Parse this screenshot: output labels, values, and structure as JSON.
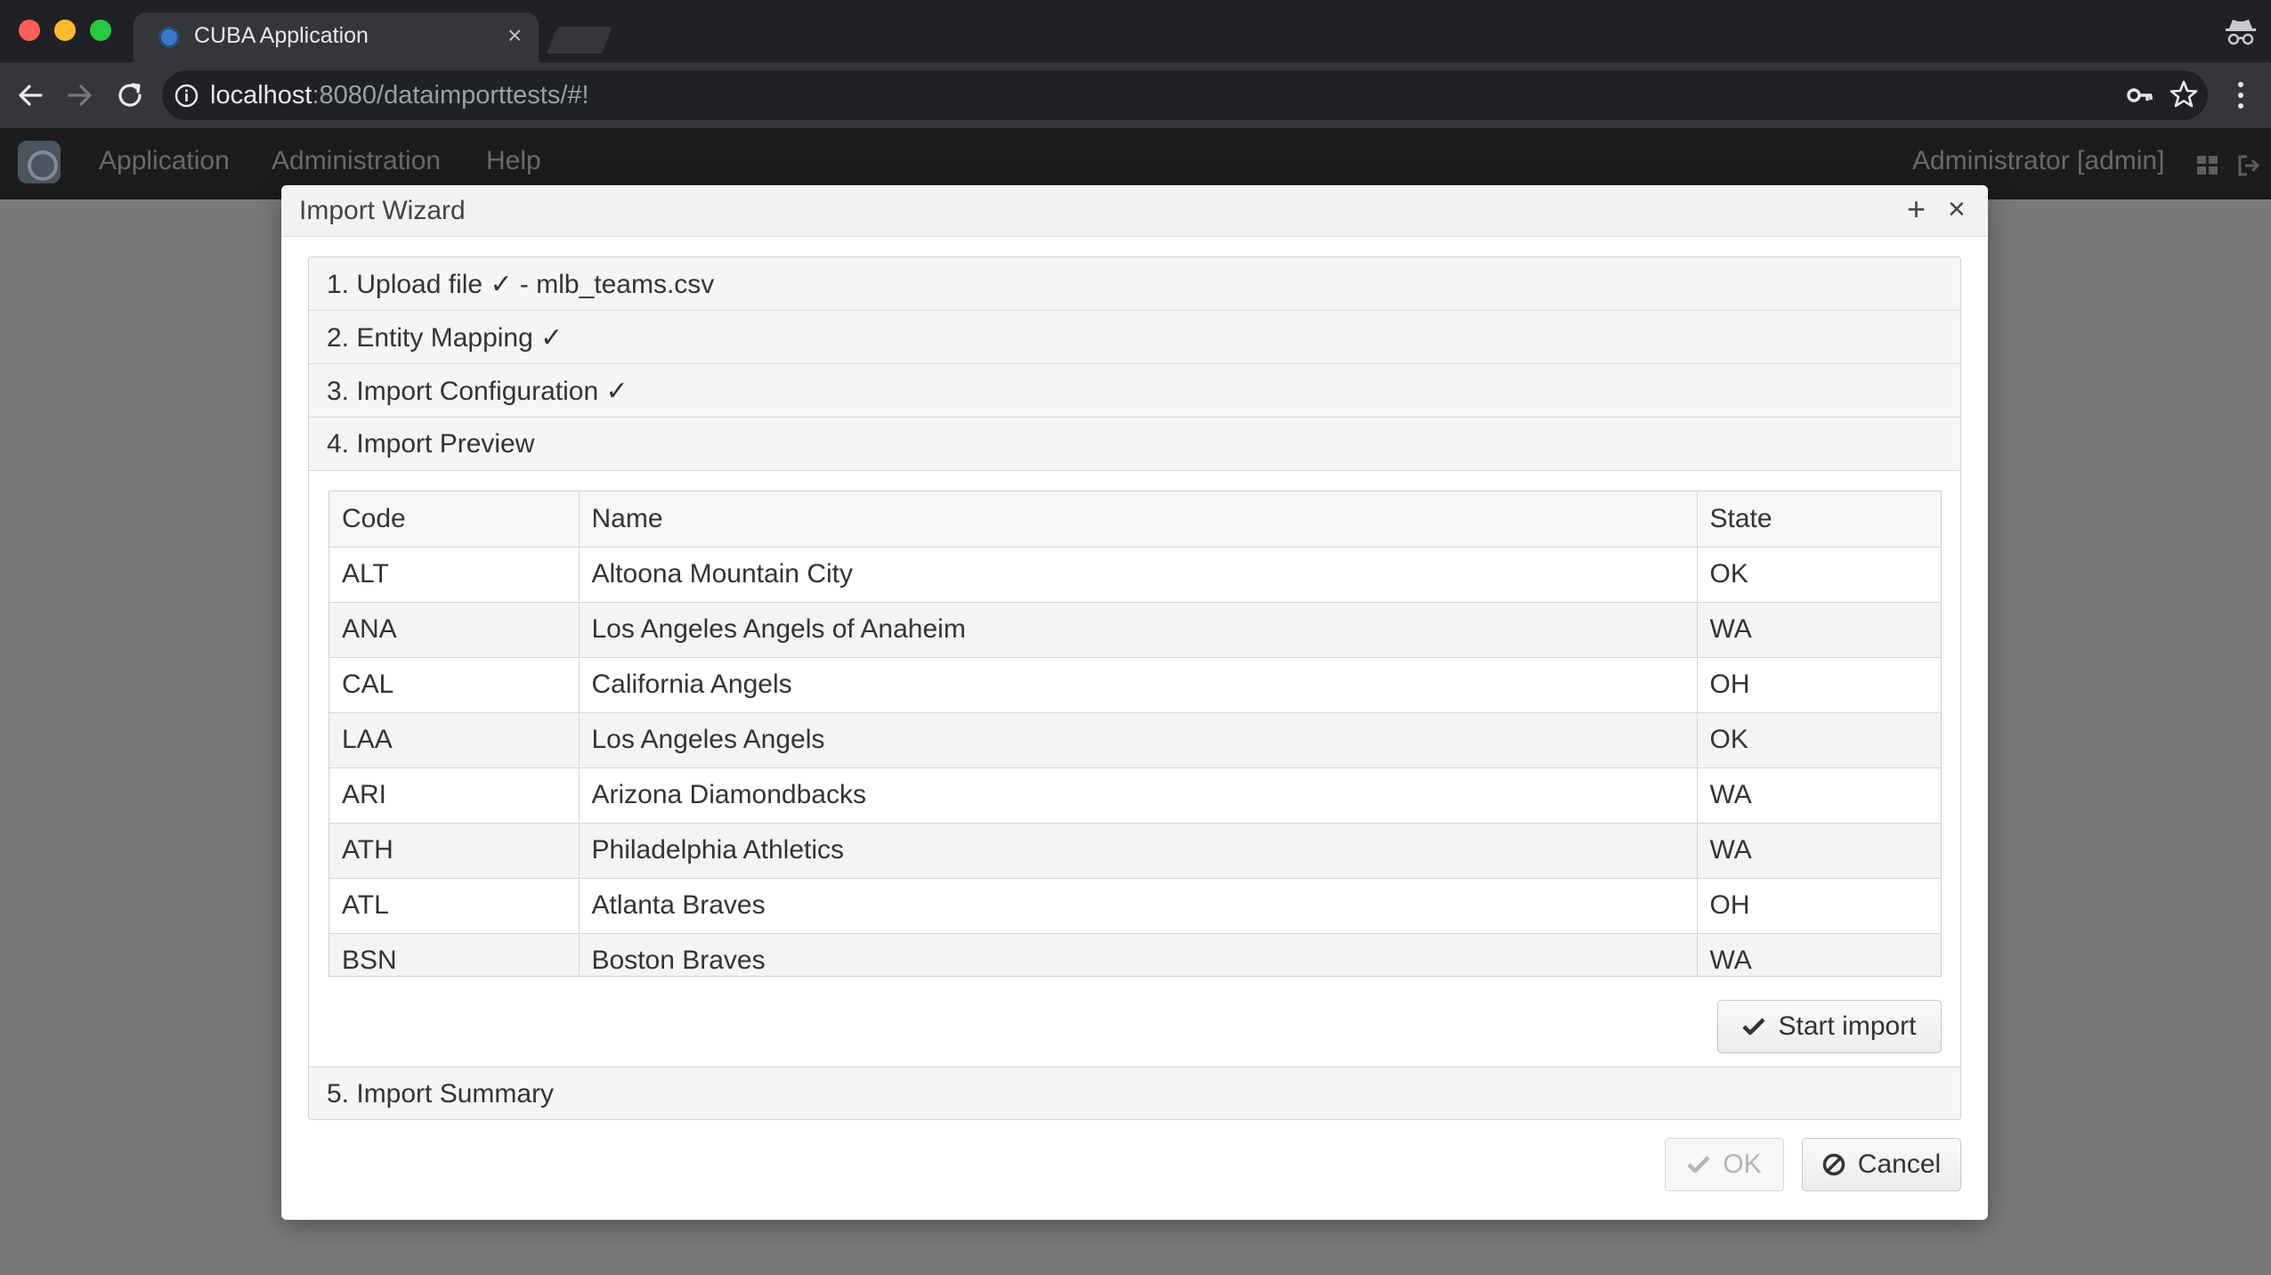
{
  "browser": {
    "tab_title": "CUBA Application",
    "tab_close": "×",
    "url_host": "localhost",
    "url_rest": ":8080/dataimporttests/#!"
  },
  "app": {
    "menu": [
      "Application",
      "Administration",
      "Help"
    ],
    "user": "Administrator [admin]"
  },
  "dialog": {
    "title": "Import Wizard",
    "maximize": "+",
    "close": "×",
    "steps": [
      "1. Upload file ✓ - mlb_teams.csv",
      "2. Entity Mapping ✓",
      "3. Import Configuration ✓",
      "4. Import Preview",
      "5. Import Summary"
    ],
    "preview": {
      "columns": [
        "Code",
        "Name",
        "State"
      ],
      "rows": [
        [
          "ALT",
          "Altoona Mountain City",
          "OK"
        ],
        [
          "ANA",
          "Los Angeles Angels of Anaheim",
          "WA"
        ],
        [
          "CAL",
          "California Angels",
          "OH"
        ],
        [
          "LAA",
          "Los Angeles Angels",
          "OK"
        ],
        [
          "ARI",
          "Arizona Diamondbacks",
          "WA"
        ],
        [
          "ATH",
          "Philadelphia Athletics",
          "WA"
        ],
        [
          "ATL",
          "Atlanta Braves",
          "OH"
        ],
        [
          "BSN",
          "Boston Braves",
          "WA"
        ]
      ],
      "start_import_label": "Start import"
    },
    "ok_label": "OK",
    "cancel_label": "Cancel"
  },
  "icons": {
    "start_import": "check-icon",
    "ok": "check-icon",
    "cancel": "ban-icon"
  }
}
